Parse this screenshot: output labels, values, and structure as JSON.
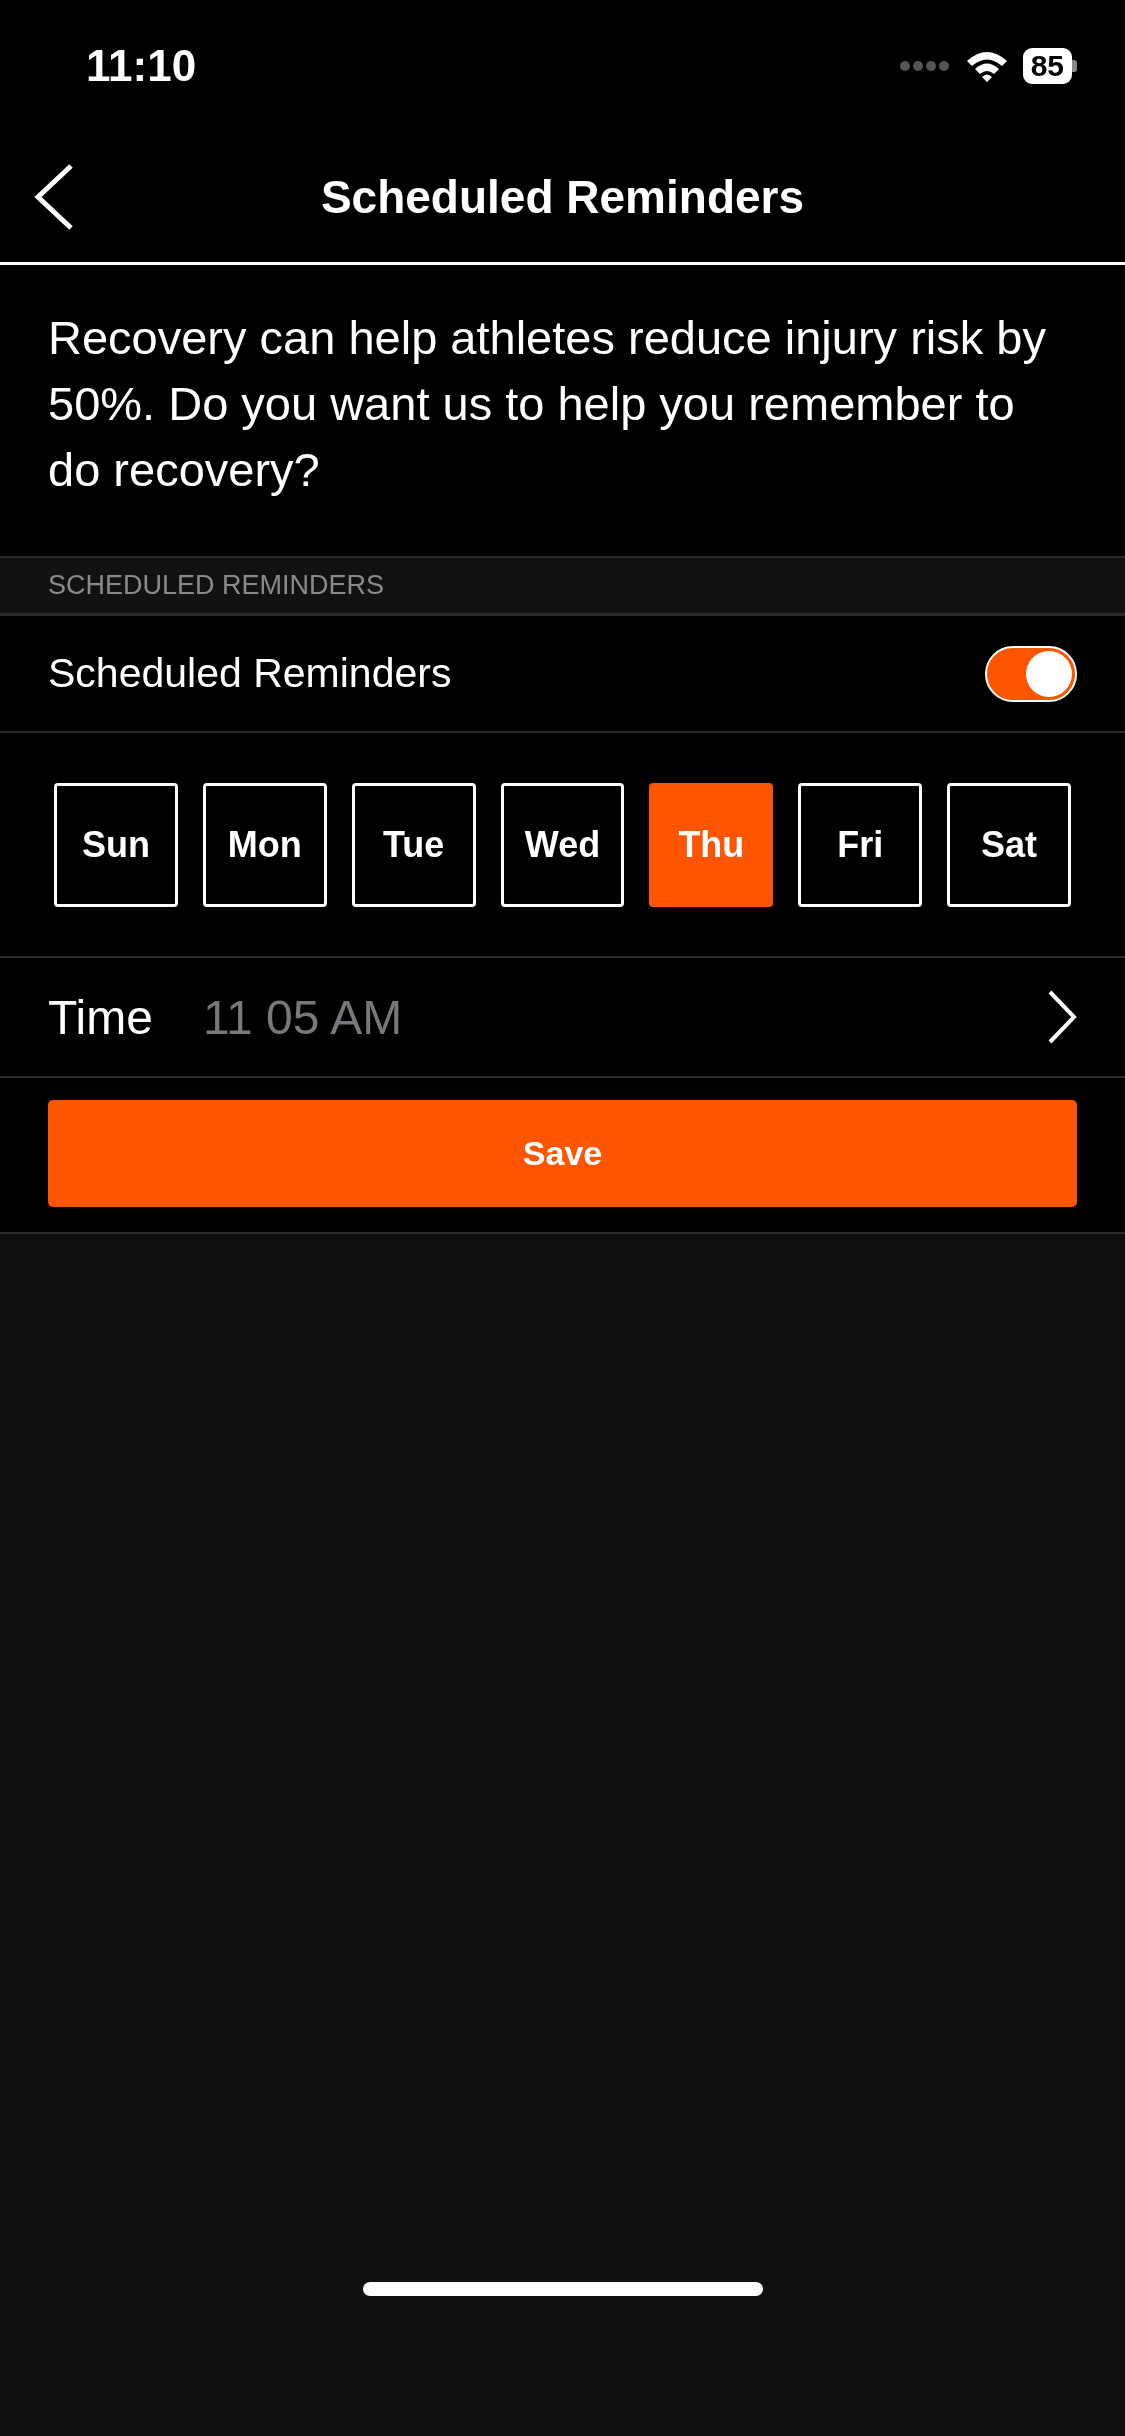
{
  "status_bar": {
    "time": "11:10",
    "battery": "85"
  },
  "nav": {
    "title": "Scheduled Reminders"
  },
  "intro": "Recovery can help athletes reduce injury risk by 50%. Do you want us to help you remember to do recovery?",
  "section_header": "SCHEDULED REMINDERS",
  "reminder_toggle": {
    "label": "Scheduled Reminders",
    "on": true
  },
  "days": [
    {
      "label": "Sun",
      "selected": false
    },
    {
      "label": "Mon",
      "selected": false
    },
    {
      "label": "Tue",
      "selected": false
    },
    {
      "label": "Wed",
      "selected": false
    },
    {
      "label": "Thu",
      "selected": true
    },
    {
      "label": "Fri",
      "selected": false
    },
    {
      "label": "Sat",
      "selected": false
    }
  ],
  "time": {
    "label": "Time",
    "value": "11 05 AM"
  },
  "save_button": "Save"
}
